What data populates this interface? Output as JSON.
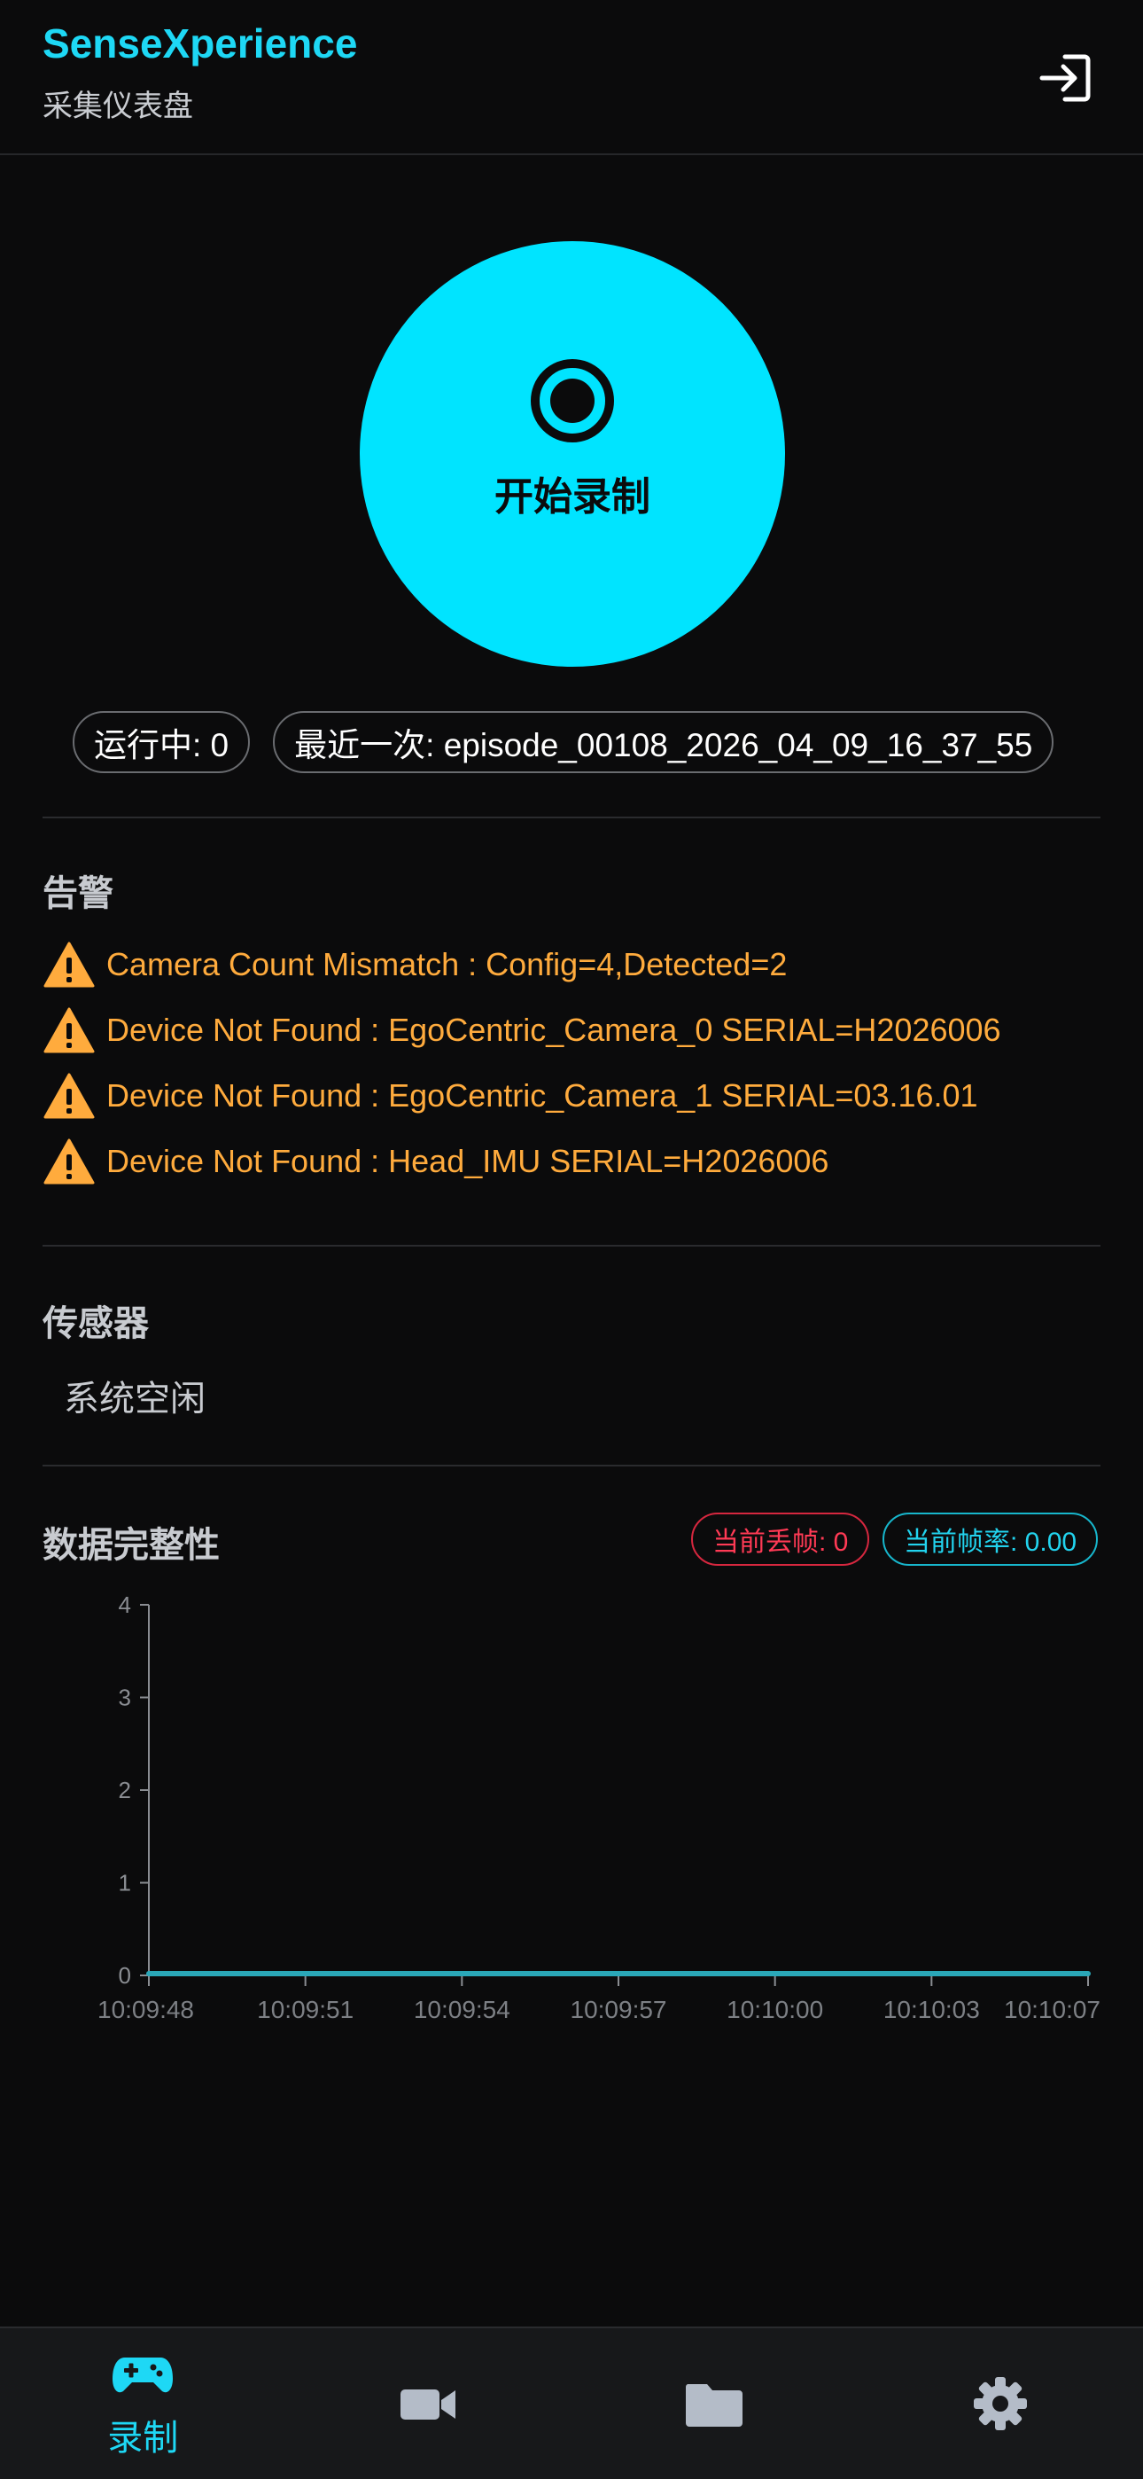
{
  "header": {
    "title": "SenseXperience",
    "subtitle": "采集仪表盘",
    "logout_icon": "logout-icon"
  },
  "record": {
    "label": "开始录制",
    "icon": "record-icon",
    "color": "#00e4ff"
  },
  "status": {
    "running": "运行中: 0",
    "latest": "最近一次: episode_00108_2026_04_09_16_37_55"
  },
  "alerts": {
    "title": "告警",
    "icon": "warning-icon",
    "color": "#ffab3d",
    "items": [
      "Camera Count Mismatch : Config=4,Detected=2",
      "Device Not Found : EgoCentric_Camera_0 SERIAL=H2026006",
      "Device Not Found : EgoCentric_Camera_1 SERIAL=03.16.01",
      "Device Not Found : Head_IMU SERIAL=H2026006"
    ]
  },
  "sensors": {
    "title": "传感器",
    "status": "系统空闲"
  },
  "integrity": {
    "title": "数据完整性",
    "dropped_frames": "当前丢帧: 0",
    "frame_rate": "当前帧率: 0.00"
  },
  "chart_data": {
    "type": "line",
    "x": [
      "10:09:48",
      "10:09:51",
      "10:09:54",
      "10:09:57",
      "10:10:00",
      "10:10:03",
      "10:10:07"
    ],
    "series": [
      {
        "values": [
          0,
          0,
          0,
          0,
          0,
          0,
          0
        ],
        "color": "#2aa7b8"
      }
    ],
    "ylim": [
      0,
      4
    ],
    "yticks": [
      0,
      1,
      2,
      3,
      4
    ],
    "grid": false
  },
  "nav": {
    "items": [
      {
        "name": "record",
        "icon": "gamepad-icon",
        "label": "录制",
        "active": true
      },
      {
        "name": "camera",
        "icon": "video-camera-icon",
        "label": "",
        "active": false
      },
      {
        "name": "files",
        "icon": "folder-icon",
        "label": "",
        "active": false
      },
      {
        "name": "settings",
        "icon": "gear-icon",
        "label": "",
        "active": false
      }
    ],
    "active_color": "#1ed8f5",
    "inactive_color": "#b4bcc8"
  }
}
